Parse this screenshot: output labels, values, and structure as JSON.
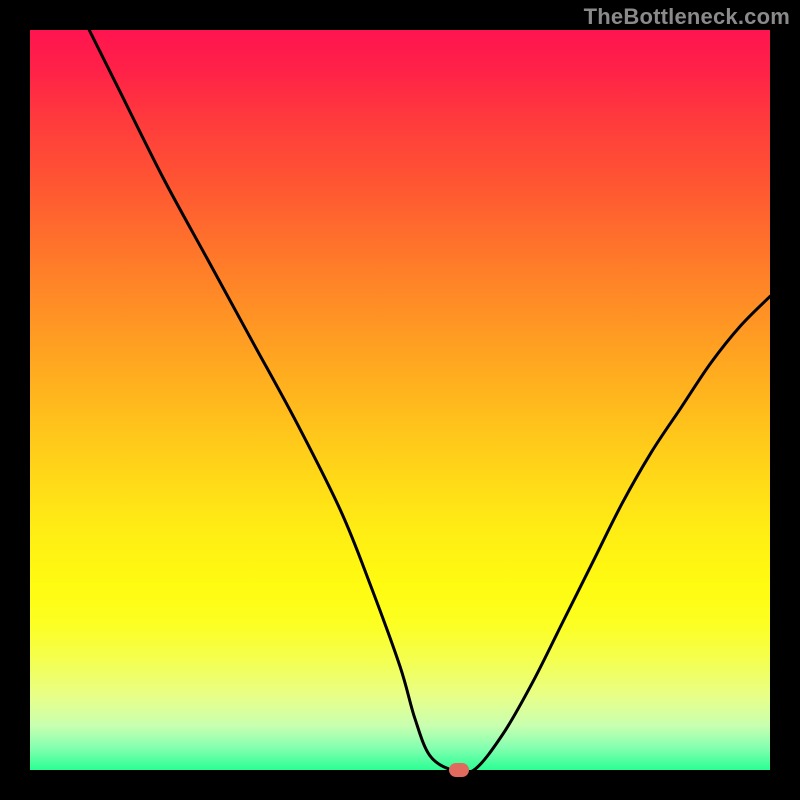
{
  "watermark": "TheBottleneck.com",
  "chart_data": {
    "type": "line",
    "title": "",
    "xlabel": "",
    "ylabel": "",
    "xlim": [
      0,
      100
    ],
    "ylim": [
      0,
      100
    ],
    "series": [
      {
        "name": "curve",
        "x": [
          8,
          12,
          18,
          24,
          30,
          36,
          42,
          46,
          50,
          52,
          54,
          57,
          60,
          64,
          68,
          72,
          76,
          80,
          84,
          88,
          92,
          96,
          100
        ],
        "y": [
          100,
          92,
          80,
          69,
          58,
          47,
          35,
          25,
          14,
          7,
          2,
          0,
          0,
          5,
          12,
          20,
          28,
          36,
          43,
          49,
          55,
          60,
          64
        ]
      }
    ],
    "marker": {
      "x": 58,
      "y": 0,
      "color": "#e06a5e"
    },
    "background_gradient": {
      "top": "#ff1450",
      "mid": "#ffee14",
      "bottom": "#2bff94"
    },
    "frame_color": "#000000"
  }
}
